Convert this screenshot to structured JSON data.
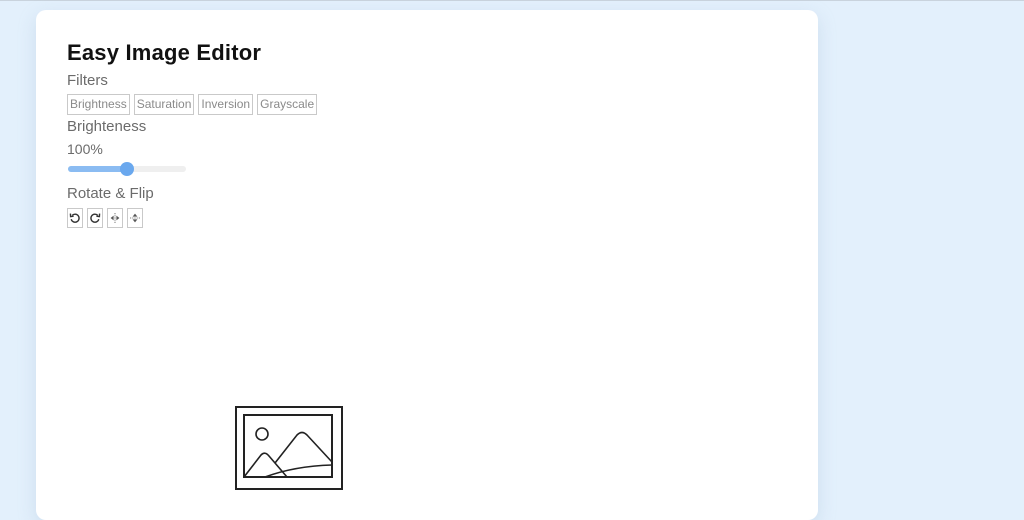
{
  "app": {
    "title": "Easy Image Editor"
  },
  "filters": {
    "label": "Filters",
    "buttons": [
      {
        "label": "Brightness"
      },
      {
        "label": "Saturation"
      },
      {
        "label": "Inversion"
      },
      {
        "label": "Grayscale"
      }
    ]
  },
  "slider": {
    "label": "Brighteness",
    "value_text": "100%",
    "fraction": 0.5
  },
  "rotate": {
    "label": "Rotate & Flip",
    "buttons": [
      {
        "icon": "rotate-left-icon"
      },
      {
        "icon": "rotate-right-icon"
      },
      {
        "icon": "flip-horizontal-icon"
      },
      {
        "icon": "flip-vertical-icon"
      }
    ]
  },
  "preview": {
    "icon": "image-placeholder-icon"
  },
  "colors": {
    "background": "#e3f0fc",
    "accent": "#6aa8ee",
    "slider_fill": "#8bbcf2"
  }
}
